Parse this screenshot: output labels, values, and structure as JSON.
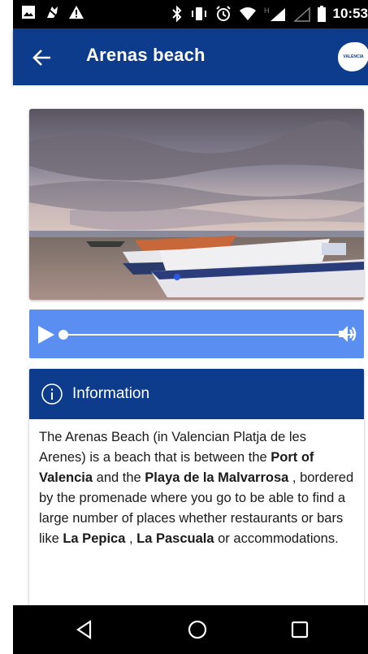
{
  "status_bar": {
    "time": "10:53"
  },
  "app_bar": {
    "title": "Arenas beach",
    "logo_text": "VALENCIA"
  },
  "info": {
    "title": "Information",
    "paragraph": [
      {
        "text": "The Arenas Beach (in Valencian Platja de les Arenes) is a beach that is between the ",
        "bold": false
      },
      {
        "text": "Port of Valencia",
        "bold": true
      },
      {
        "text": " and the ",
        "bold": false
      },
      {
        "text": "Playa de la Malvarrosa",
        "bold": true
      },
      {
        "text": " , bordered by the promenade where you go to be able to find a large number of places whether restaurants or bars like ",
        "bold": false
      },
      {
        "text": "La Pepica",
        "bold": true
      },
      {
        "text": " , ",
        "bold": false
      },
      {
        "text": "La Pascuala",
        "bold": true
      },
      {
        "text": " or accommodations.",
        "bold": false
      }
    ]
  },
  "player": {
    "progress": 0.0
  },
  "colors": {
    "primary": "#0d3c8c",
    "player": "#5a8ef0",
    "status_bar": "#000000"
  },
  "icons": {
    "back": "arrow-left-icon",
    "play": "play-icon",
    "volume": "volume-icon",
    "info": "info-circle-icon"
  }
}
